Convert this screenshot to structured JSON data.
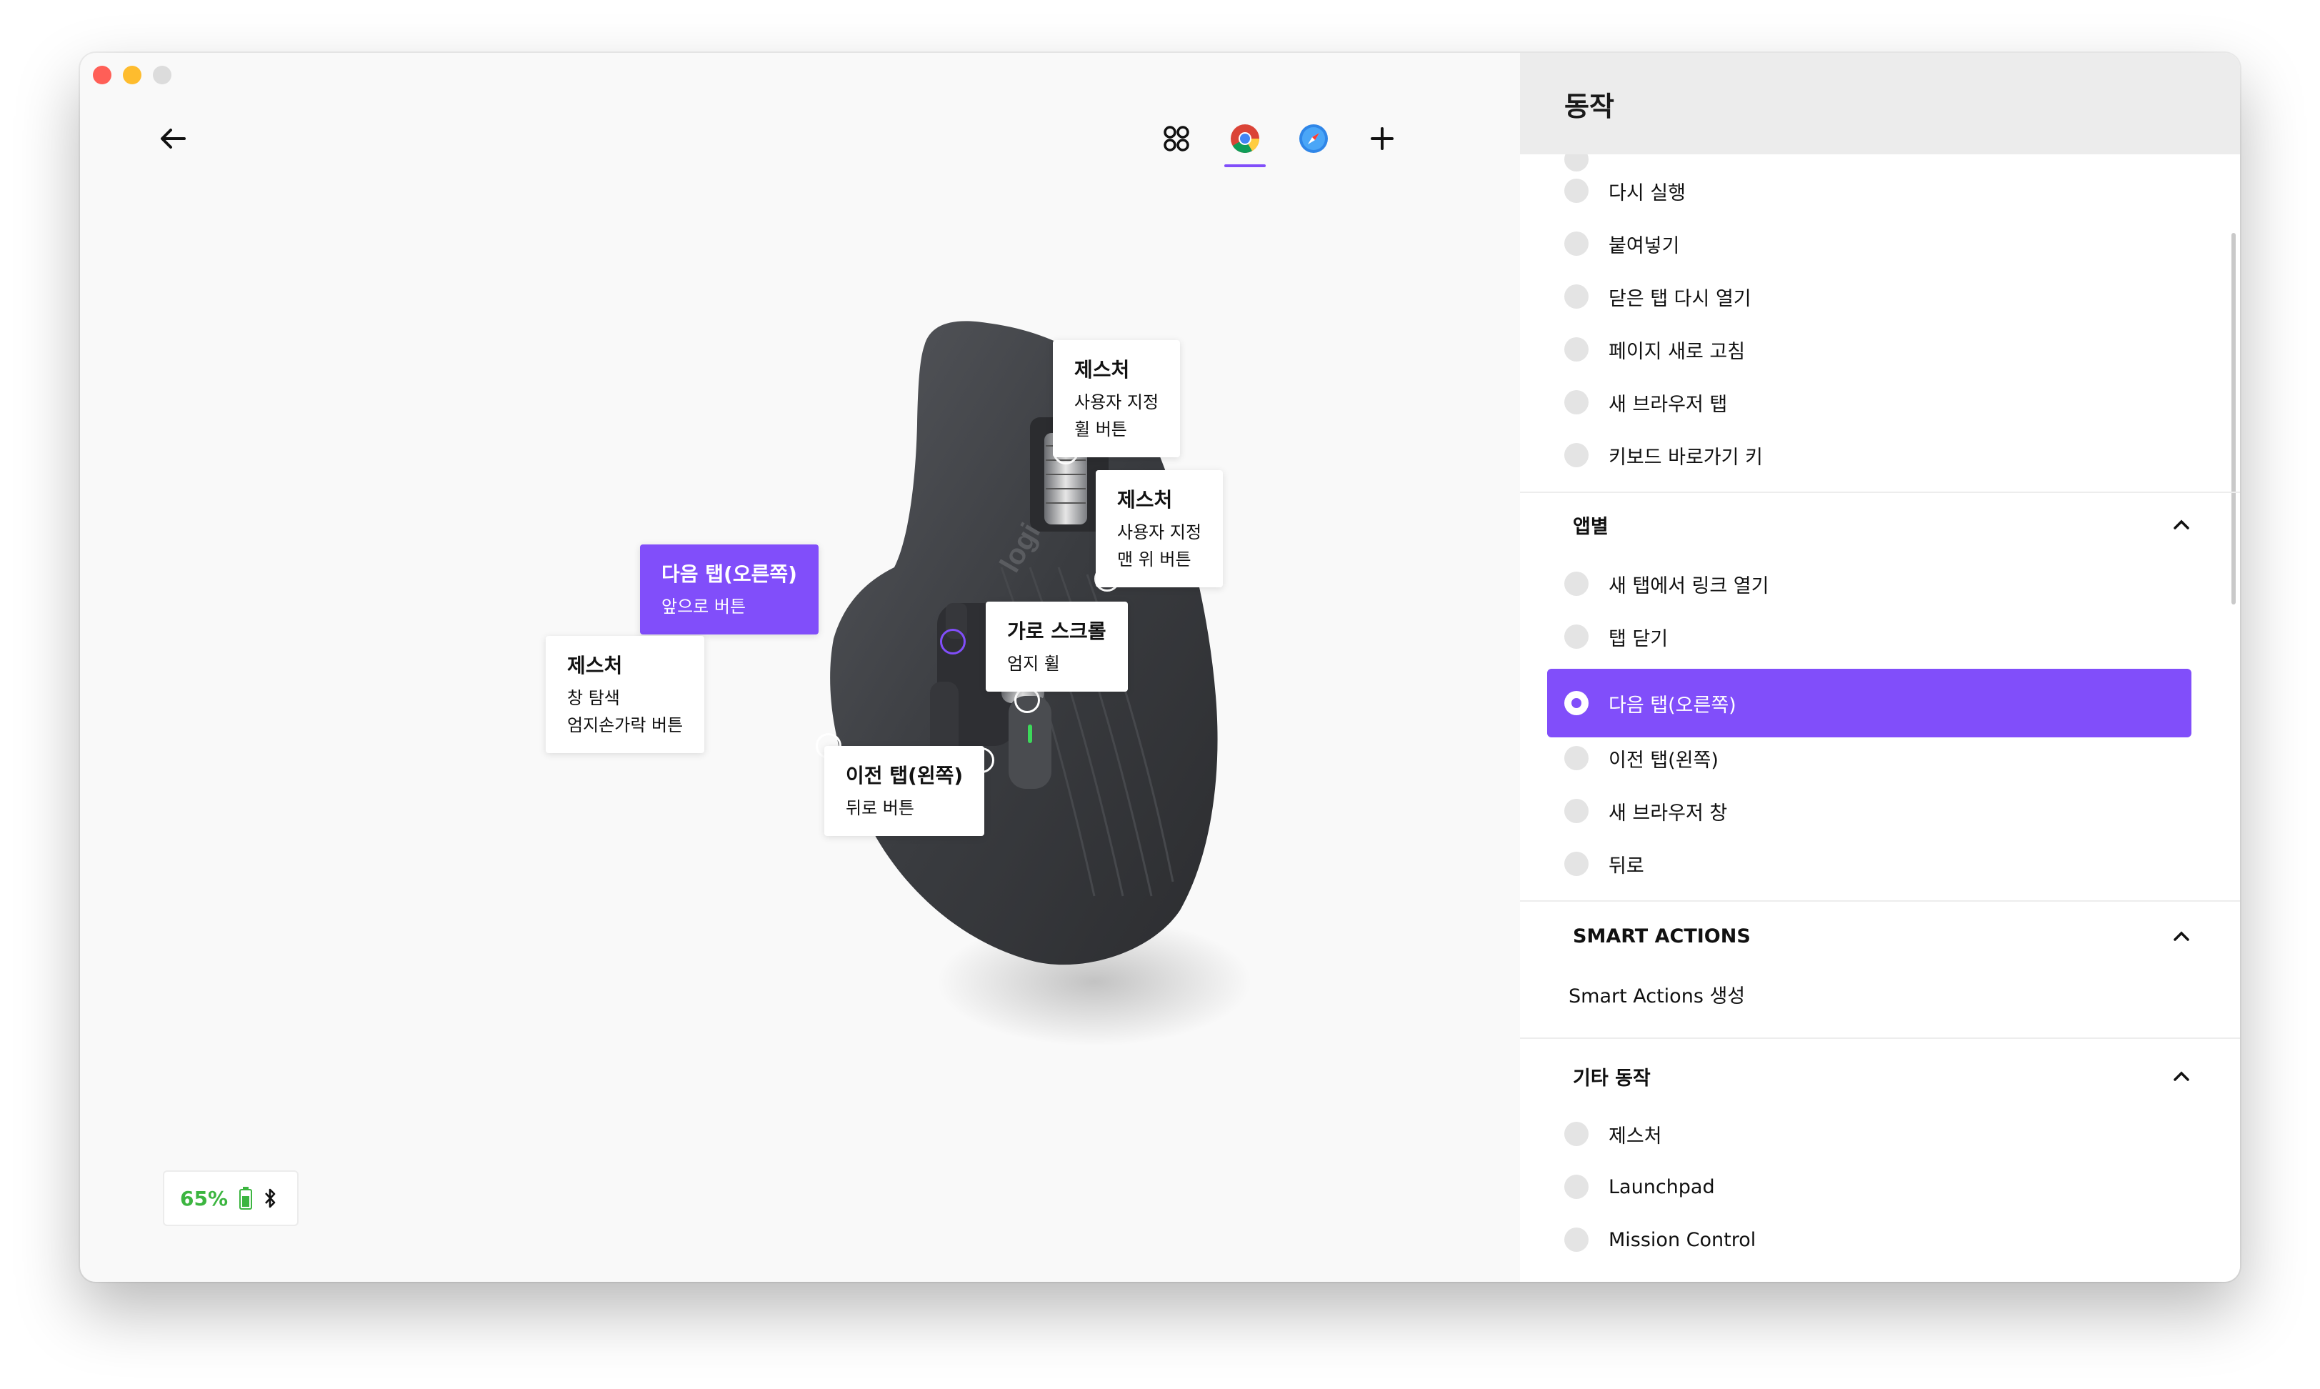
{
  "toolbar": {
    "back_icon": "arrow-left-icon",
    "app_tabs": [
      {
        "name": "all-apps",
        "icon": "grid-icon"
      },
      {
        "name": "chrome",
        "icon": "chrome-icon",
        "active": true
      },
      {
        "name": "safari",
        "icon": "safari-icon"
      },
      {
        "name": "add-app",
        "icon": "plus-icon"
      }
    ]
  },
  "callouts": {
    "wheel": {
      "title": "제스처",
      "line1": "사용자 지정",
      "line2": "휠 버튼"
    },
    "top": {
      "title": "제스처",
      "line1": "사용자 지정",
      "line2": "맨 위 버튼"
    },
    "forward": {
      "title": "다음 탭(오른쪽)",
      "line1": "앞으로 버튼"
    },
    "hscroll": {
      "title": "가로 스크롤",
      "line1": "엄지 휠"
    },
    "thumb": {
      "title": "제스처",
      "line1": "창 탐색",
      "line2": "엄지손가락 버튼"
    },
    "back": {
      "title": "이전 탭(왼쪽)",
      "line1": "뒤로 버튼"
    }
  },
  "device": {
    "logo": "logi"
  },
  "battery": {
    "percent": "65%",
    "level": 0.65,
    "color": "#3cb540"
  },
  "panel": {
    "title": "동작",
    "general_items": [
      "다시 실행",
      "붙여넣기",
      "닫은 탭 다시 열기",
      "페이지 새로 고침",
      "새 브라우저 탭",
      "키보드 바로가기 키"
    ],
    "app_section": {
      "title": "앱별",
      "items": [
        "새 탭에서 링크 열기",
        "탭 닫기",
        "다음 탭(오른쪽)",
        "이전 탭(왼쪽)",
        "새 브라우저 창",
        "뒤로"
      ],
      "selected": "다음 탭(오른쪽)"
    },
    "smart_section": {
      "title": "SMART ACTIONS",
      "link": "Smart Actions 생성"
    },
    "other_section": {
      "title": "기타 동작",
      "items": [
        "제스처",
        "Launchpad",
        "Mission Control"
      ]
    }
  },
  "colors": {
    "accent": "#814efa",
    "panel_header": "#ececec"
  }
}
